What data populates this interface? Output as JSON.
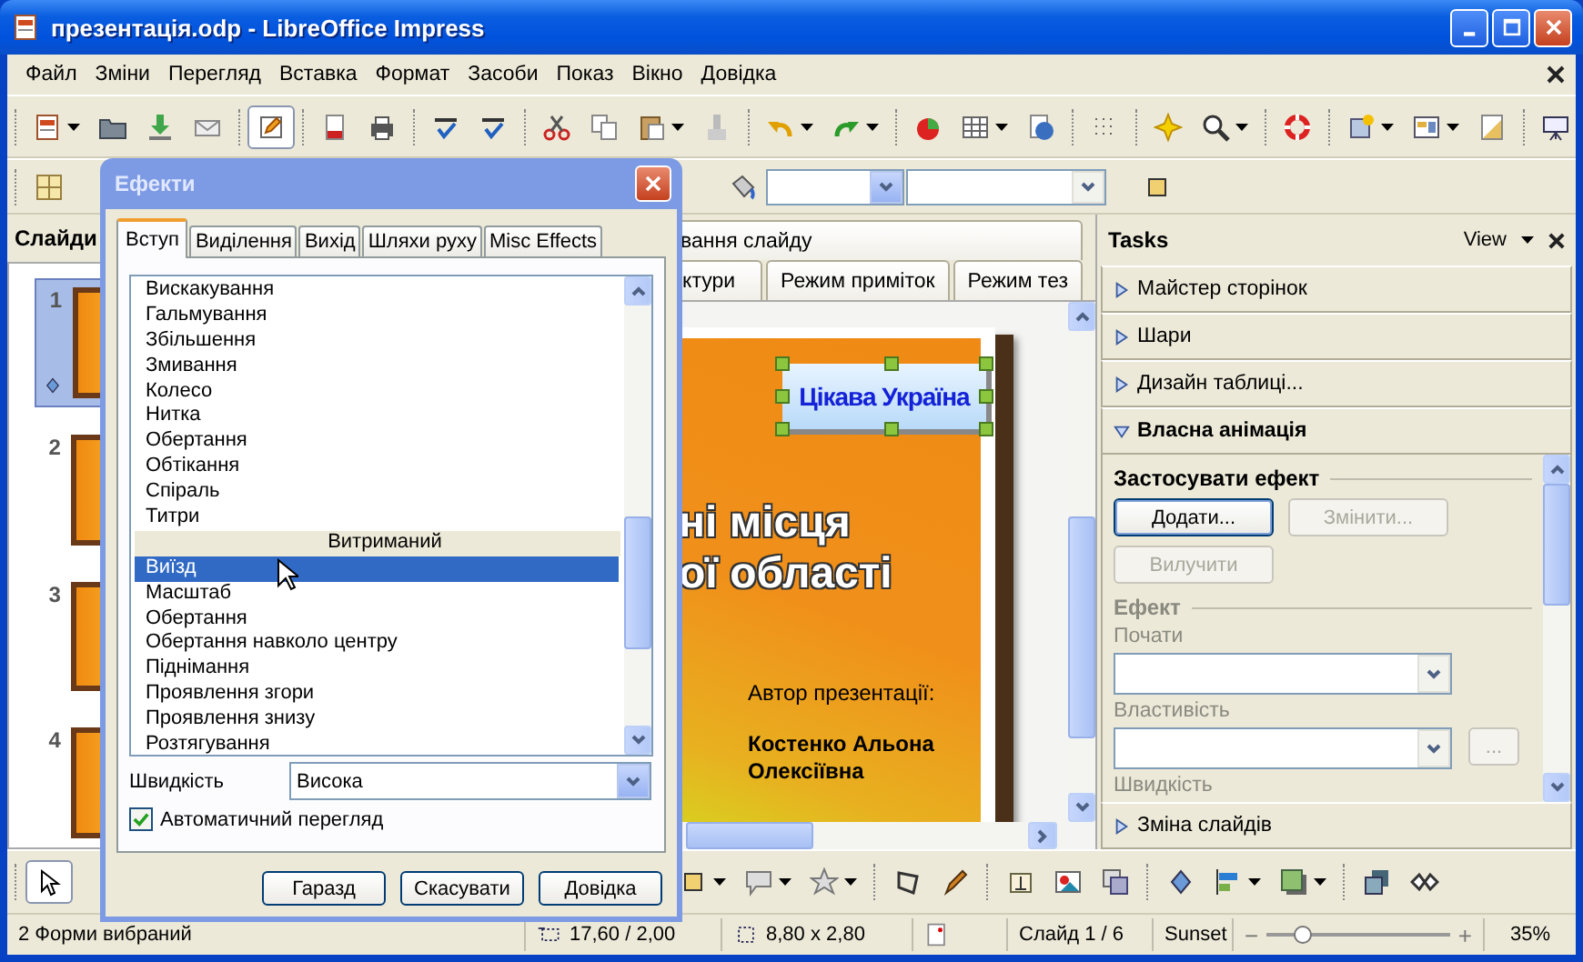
{
  "window": {
    "title": "презентація.odp - LibreOffice Impress"
  },
  "menu": [
    "Файл",
    "Зміни",
    "Перегляд",
    "Вставка",
    "Формат",
    "Засоби",
    "Показ",
    "Вікно",
    "Довідка"
  ],
  "slides_panel": {
    "title": "Слайди",
    "slides": [
      {
        "number": "1",
        "selected": true
      },
      {
        "number": "2",
        "selected": false
      },
      {
        "number": "3",
        "selected": false
      },
      {
        "number": "4",
        "selected": false
      }
    ]
  },
  "view_tabs": {
    "row_1": [
      {
        "label": "вання слайду",
        "selected": false
      }
    ],
    "row_2": [
      {
        "label": "ктури",
        "selected": false
      },
      {
        "label": "Режим приміток",
        "selected": false
      },
      {
        "label": "Режим тез",
        "selected": false
      }
    ]
  },
  "slide": {
    "wordart": "Цікава Україна",
    "title_lines": [
      "ні місця",
      "ої області"
    ],
    "author_label": "Автор презентації:",
    "author_name": "Костенко Альона Олексіївна"
  },
  "tasks": {
    "title": "Tasks",
    "view": "View",
    "sections": [
      {
        "label": "Майстер сторінок",
        "expanded": false
      },
      {
        "label": "Шари",
        "expanded": false
      },
      {
        "label": "Дизайн таблиці...",
        "expanded": false
      },
      {
        "label": "Власна анімація",
        "expanded": true,
        "panel": {
          "apply_heading": "Застосувати ефект",
          "buttons": [
            {
              "label": "Додати...",
              "disabled": false
            },
            {
              "label": "Змінити...",
              "disabled": true
            },
            {
              "label": "Вилучити",
              "disabled": true
            }
          ],
          "effect_heading": "Ефект",
          "fields": [
            {
              "label": "Почати"
            },
            {
              "label": "Властивість",
              "more": "..."
            }
          ],
          "speed_label": "Швидкість"
        }
      },
      {
        "label": "Зміна слайдів",
        "expanded": false
      }
    ]
  },
  "dialog": {
    "title": "Ефекти",
    "tabs": [
      {
        "label": "Вступ",
        "selected": true
      },
      {
        "label": "Виділення",
        "selected": false
      },
      {
        "label": "Вихід",
        "selected": false
      },
      {
        "label": "Шляхи руху",
        "selected": false
      },
      {
        "label": "Misc Effects",
        "selected": false
      }
    ],
    "effects": [
      {
        "kind": "item",
        "label": "Вискакування",
        "selected": false
      },
      {
        "kind": "item",
        "label": "Гальмування",
        "selected": false
      },
      {
        "kind": "item",
        "label": "Збільшення",
        "selected": false
      },
      {
        "kind": "item",
        "label": "Змивання",
        "selected": false
      },
      {
        "kind": "item",
        "label": "Колесо",
        "selected": false
      },
      {
        "kind": "item",
        "label": "Нитка",
        "selected": false
      },
      {
        "kind": "item",
        "label": "Обертання",
        "selected": false
      },
      {
        "kind": "item",
        "label": "Обтікання",
        "selected": false
      },
      {
        "kind": "item",
        "label": "Спіраль",
        "selected": false
      },
      {
        "kind": "item",
        "label": "Титри",
        "selected": false
      },
      {
        "kind": "group",
        "label": "Витриманий"
      },
      {
        "kind": "item",
        "label": "Виїзд",
        "selected": true
      },
      {
        "kind": "item",
        "label": "Масштаб",
        "selected": false
      },
      {
        "kind": "item",
        "label": "Обертання",
        "selected": false
      },
      {
        "kind": "item",
        "label": "Обертання навколо центру",
        "selected": false
      },
      {
        "kind": "item",
        "label": "Піднімання",
        "selected": false
      },
      {
        "kind": "item",
        "label": "Проявлення згори",
        "selected": false
      },
      {
        "kind": "item",
        "label": "Проявлення знизу",
        "selected": false
      },
      {
        "kind": "item",
        "label": "Розтягування",
        "selected": false
      }
    ],
    "speed": {
      "label": "Швидкість",
      "value": "Висока"
    },
    "auto_preview": {
      "label": "Автоматичний перегляд",
      "checked": true
    },
    "buttons": [
      "Гаразд",
      "Скасувати",
      "Довідка"
    ]
  },
  "status_bar": {
    "selection": "2 Форми вибраний",
    "position": "17,60 / 2,00",
    "size": "8,80 x 2,80",
    "slide": "Слайд 1 / 6",
    "design": "Sunset",
    "zoom": {
      "zoom_out": "−",
      "zoom_in": "+",
      "level": 0.2,
      "reading": "35%"
    }
  }
}
